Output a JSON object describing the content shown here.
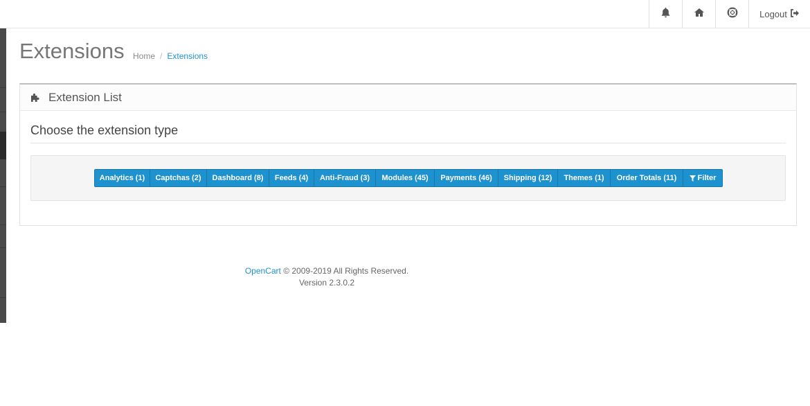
{
  "header": {
    "nav": {
      "notifications_icon": "bell-icon",
      "home_icon": "home-icon",
      "help_icon": "life-ring-icon",
      "logout_label": "Logout",
      "logout_icon": "sign-out-icon"
    }
  },
  "page": {
    "title": "Extensions",
    "breadcrumb": [
      {
        "label": "Home"
      },
      {
        "label": "Extensions"
      }
    ]
  },
  "panel": {
    "icon": "puzzle-piece-icon",
    "title": "Extension List",
    "legend": "Choose the extension type",
    "types": [
      {
        "label": "Analytics (1)"
      },
      {
        "label": "Captchas (2)"
      },
      {
        "label": "Dashboard (8)"
      },
      {
        "label": "Feeds (4)"
      },
      {
        "label": "Anti-Fraud (3)"
      },
      {
        "label": "Modules (45)"
      },
      {
        "label": "Payments (46)"
      },
      {
        "label": "Shipping (12)"
      },
      {
        "label": "Themes (1)"
      },
      {
        "label": "Order Totals (11)"
      }
    ],
    "filter_label": "Filter",
    "filter_icon": "filter-icon"
  },
  "footer": {
    "brand": "OpenCart",
    "copyright": "© 2009-2019 All Rights Reserved.",
    "version": "Version 2.3.0.2"
  },
  "colors": {
    "accent": "#1e91cf",
    "sidebar": "#4a4a4a"
  }
}
